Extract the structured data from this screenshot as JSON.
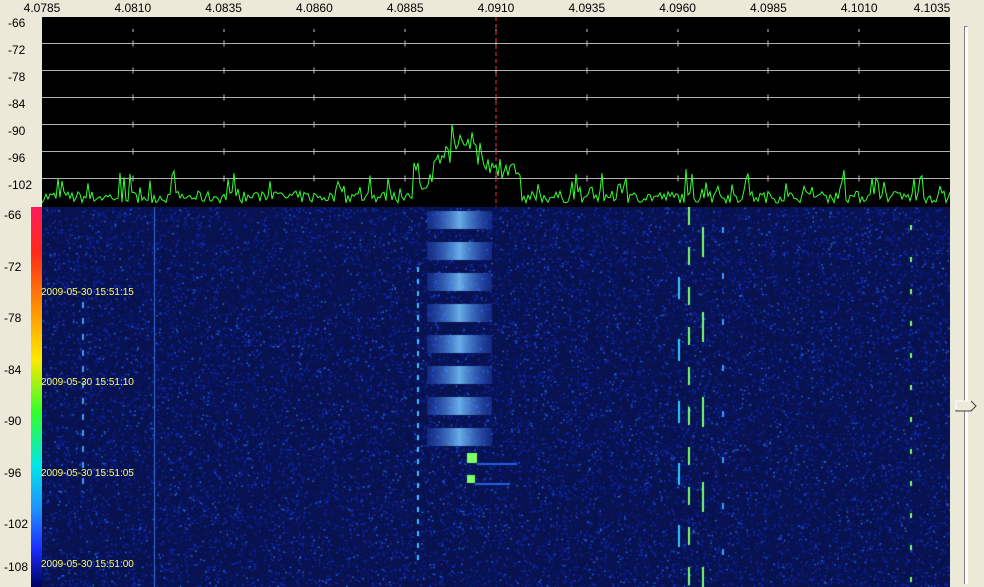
{
  "frequency_axis": {
    "labels": [
      "4.0785",
      "4.0810",
      "4.0835",
      "4.0860",
      "4.0885",
      "4.0910",
      "4.0935",
      "4.0960",
      "4.0985",
      "4.1010",
      "4.1035"
    ]
  },
  "spectrum": {
    "db_labels": [
      "-66",
      "-72",
      "-78",
      "-84",
      "-90",
      "-96",
      "-102"
    ]
  },
  "waterfall": {
    "db_labels": [
      "-66",
      "-72",
      "-78",
      "-84",
      "-90",
      "-96",
      "-102",
      "-108"
    ],
    "timestamps": [
      "2009-05-30 15:51:15",
      "2009-05-30 15:51:10",
      "2009-05-30 15:51:05",
      "2009-05-30 15:51:00"
    ]
  },
  "colors": {
    "trace": "#33ff33",
    "marker": "#ff3030",
    "timestamp": "#ffff66",
    "waterfall_bg": "#08124f"
  },
  "icons": {
    "slider": "slider-thumb-icon"
  }
}
